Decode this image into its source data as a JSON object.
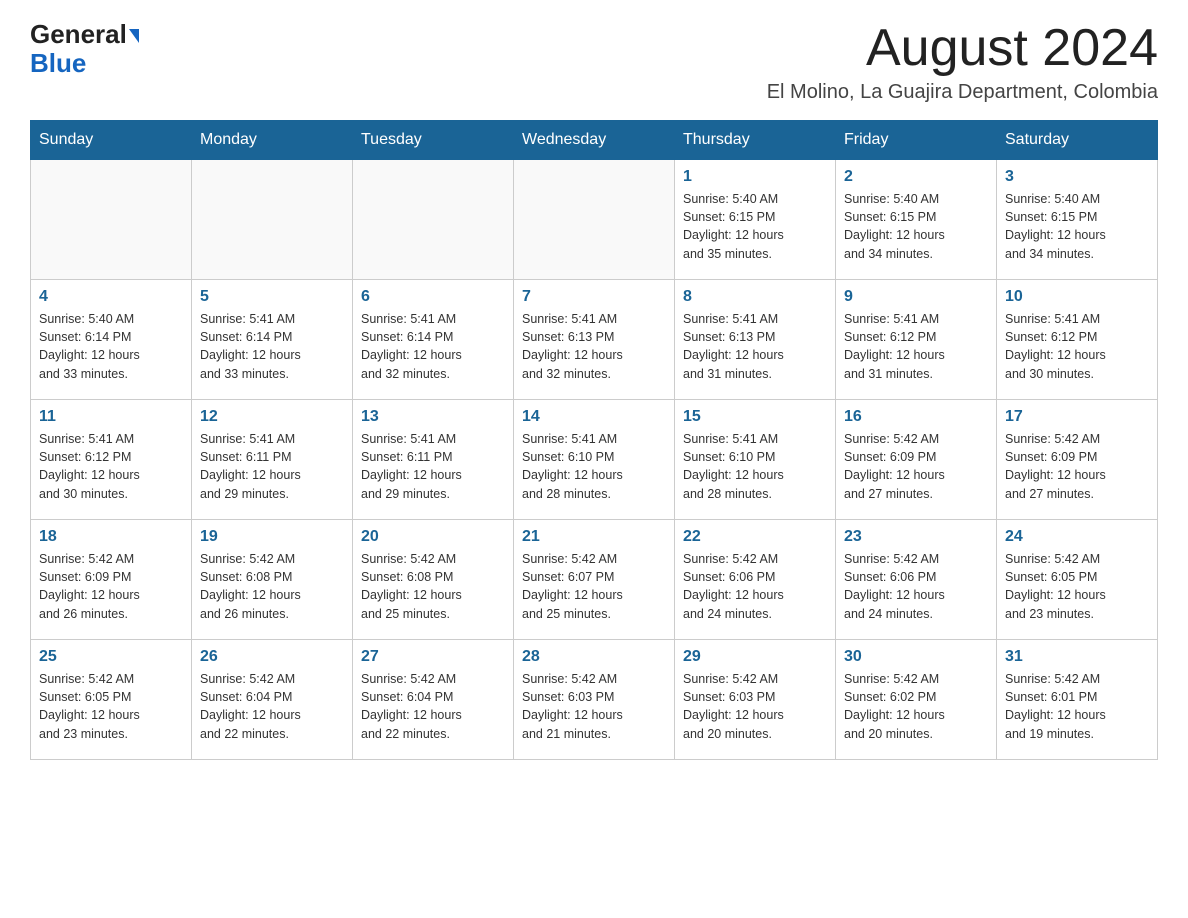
{
  "header": {
    "logo_text_general": "General",
    "logo_text_blue": "Blue",
    "month_title": "August 2024",
    "location": "El Molino, La Guajira Department, Colombia"
  },
  "days_of_week": [
    "Sunday",
    "Monday",
    "Tuesday",
    "Wednesday",
    "Thursday",
    "Friday",
    "Saturday"
  ],
  "weeks": [
    [
      {
        "day": "",
        "info": ""
      },
      {
        "day": "",
        "info": ""
      },
      {
        "day": "",
        "info": ""
      },
      {
        "day": "",
        "info": ""
      },
      {
        "day": "1",
        "info": "Sunrise: 5:40 AM\nSunset: 6:15 PM\nDaylight: 12 hours\nand 35 minutes."
      },
      {
        "day": "2",
        "info": "Sunrise: 5:40 AM\nSunset: 6:15 PM\nDaylight: 12 hours\nand 34 minutes."
      },
      {
        "day": "3",
        "info": "Sunrise: 5:40 AM\nSunset: 6:15 PM\nDaylight: 12 hours\nand 34 minutes."
      }
    ],
    [
      {
        "day": "4",
        "info": "Sunrise: 5:40 AM\nSunset: 6:14 PM\nDaylight: 12 hours\nand 33 minutes."
      },
      {
        "day": "5",
        "info": "Sunrise: 5:41 AM\nSunset: 6:14 PM\nDaylight: 12 hours\nand 33 minutes."
      },
      {
        "day": "6",
        "info": "Sunrise: 5:41 AM\nSunset: 6:14 PM\nDaylight: 12 hours\nand 32 minutes."
      },
      {
        "day": "7",
        "info": "Sunrise: 5:41 AM\nSunset: 6:13 PM\nDaylight: 12 hours\nand 32 minutes."
      },
      {
        "day": "8",
        "info": "Sunrise: 5:41 AM\nSunset: 6:13 PM\nDaylight: 12 hours\nand 31 minutes."
      },
      {
        "day": "9",
        "info": "Sunrise: 5:41 AM\nSunset: 6:12 PM\nDaylight: 12 hours\nand 31 minutes."
      },
      {
        "day": "10",
        "info": "Sunrise: 5:41 AM\nSunset: 6:12 PM\nDaylight: 12 hours\nand 30 minutes."
      }
    ],
    [
      {
        "day": "11",
        "info": "Sunrise: 5:41 AM\nSunset: 6:12 PM\nDaylight: 12 hours\nand 30 minutes."
      },
      {
        "day": "12",
        "info": "Sunrise: 5:41 AM\nSunset: 6:11 PM\nDaylight: 12 hours\nand 29 minutes."
      },
      {
        "day": "13",
        "info": "Sunrise: 5:41 AM\nSunset: 6:11 PM\nDaylight: 12 hours\nand 29 minutes."
      },
      {
        "day": "14",
        "info": "Sunrise: 5:41 AM\nSunset: 6:10 PM\nDaylight: 12 hours\nand 28 minutes."
      },
      {
        "day": "15",
        "info": "Sunrise: 5:41 AM\nSunset: 6:10 PM\nDaylight: 12 hours\nand 28 minutes."
      },
      {
        "day": "16",
        "info": "Sunrise: 5:42 AM\nSunset: 6:09 PM\nDaylight: 12 hours\nand 27 minutes."
      },
      {
        "day": "17",
        "info": "Sunrise: 5:42 AM\nSunset: 6:09 PM\nDaylight: 12 hours\nand 27 minutes."
      }
    ],
    [
      {
        "day": "18",
        "info": "Sunrise: 5:42 AM\nSunset: 6:09 PM\nDaylight: 12 hours\nand 26 minutes."
      },
      {
        "day": "19",
        "info": "Sunrise: 5:42 AM\nSunset: 6:08 PM\nDaylight: 12 hours\nand 26 minutes."
      },
      {
        "day": "20",
        "info": "Sunrise: 5:42 AM\nSunset: 6:08 PM\nDaylight: 12 hours\nand 25 minutes."
      },
      {
        "day": "21",
        "info": "Sunrise: 5:42 AM\nSunset: 6:07 PM\nDaylight: 12 hours\nand 25 minutes."
      },
      {
        "day": "22",
        "info": "Sunrise: 5:42 AM\nSunset: 6:06 PM\nDaylight: 12 hours\nand 24 minutes."
      },
      {
        "day": "23",
        "info": "Sunrise: 5:42 AM\nSunset: 6:06 PM\nDaylight: 12 hours\nand 24 minutes."
      },
      {
        "day": "24",
        "info": "Sunrise: 5:42 AM\nSunset: 6:05 PM\nDaylight: 12 hours\nand 23 minutes."
      }
    ],
    [
      {
        "day": "25",
        "info": "Sunrise: 5:42 AM\nSunset: 6:05 PM\nDaylight: 12 hours\nand 23 minutes."
      },
      {
        "day": "26",
        "info": "Sunrise: 5:42 AM\nSunset: 6:04 PM\nDaylight: 12 hours\nand 22 minutes."
      },
      {
        "day": "27",
        "info": "Sunrise: 5:42 AM\nSunset: 6:04 PM\nDaylight: 12 hours\nand 22 minutes."
      },
      {
        "day": "28",
        "info": "Sunrise: 5:42 AM\nSunset: 6:03 PM\nDaylight: 12 hours\nand 21 minutes."
      },
      {
        "day": "29",
        "info": "Sunrise: 5:42 AM\nSunset: 6:03 PM\nDaylight: 12 hours\nand 20 minutes."
      },
      {
        "day": "30",
        "info": "Sunrise: 5:42 AM\nSunset: 6:02 PM\nDaylight: 12 hours\nand 20 minutes."
      },
      {
        "day": "31",
        "info": "Sunrise: 5:42 AM\nSunset: 6:01 PM\nDaylight: 12 hours\nand 19 minutes."
      }
    ]
  ]
}
